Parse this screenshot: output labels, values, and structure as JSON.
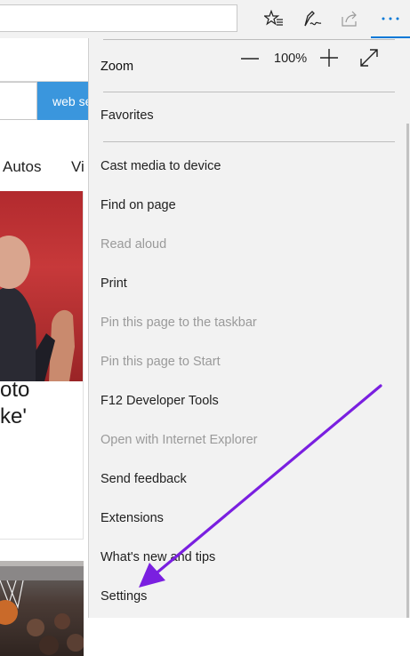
{
  "toolbar": {
    "icons": [
      "favorites-star-icon",
      "pen-notes-icon",
      "share-icon",
      "more-dots-icon"
    ]
  },
  "page": {
    "search_button": "web se",
    "nav": [
      "Autos",
      "Vi"
    ],
    "headline_lines": [
      "oto",
      "ke'"
    ]
  },
  "menu": {
    "zoom_label": "Zoom",
    "zoom_value": "100%",
    "favorites": "Favorites",
    "items": [
      {
        "label": "Cast media to device",
        "disabled": false
      },
      {
        "label": "Find on page",
        "disabled": false
      },
      {
        "label": "Read aloud",
        "disabled": true
      },
      {
        "label": "Print",
        "disabled": false
      },
      {
        "label": "Pin this page to the taskbar",
        "disabled": true
      },
      {
        "label": "Pin this page to Start",
        "disabled": true
      },
      {
        "label": "F12 Developer Tools",
        "disabled": false
      },
      {
        "label": "Open with Internet Explorer",
        "disabled": true
      },
      {
        "label": "Send feedback",
        "disabled": false
      },
      {
        "label": "Extensions",
        "disabled": false
      },
      {
        "label": "What's new and tips",
        "disabled": false
      },
      {
        "label": "Settings",
        "disabled": false
      }
    ]
  },
  "colors": {
    "accent": "#0078d7",
    "menu_bg": "#f2f2f2",
    "disabled_text": "#9a9a9a",
    "arrow": "#7a1fe0"
  }
}
